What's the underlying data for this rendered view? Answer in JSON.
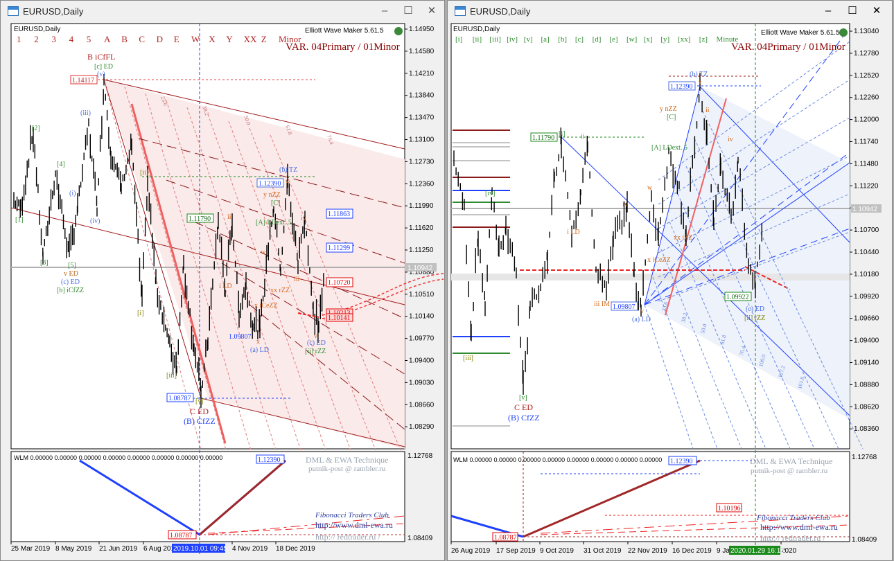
{
  "left": {
    "title": "EURUSD,Daily",
    "chart_label": "EURUSD,Daily",
    "ewm": "Elliott Wave Maker 5.61.5",
    "variant": "VAR. 04Primary / 01Minor",
    "wave_buttons": [
      "1",
      "2",
      "3",
      "4",
      "5",
      "A",
      "B",
      "C",
      "D",
      "E",
      "W",
      "X",
      "Y",
      "XX",
      "Z",
      "Minor"
    ],
    "price_axis": [
      "1.14950",
      "1.14580",
      "1.14210",
      "1.13840",
      "1.13470",
      "1.13100",
      "1.12730",
      "1.12360",
      "1.11990",
      "1.11620",
      "1.11250",
      "1.10880",
      "1.10510",
      "1.10140",
      "1.09770",
      "1.09400",
      "1.09030",
      "1.08660",
      "1.08290"
    ],
    "current_price": "1.10942",
    "price_tags": {
      "p1": "1.14117",
      "p2": "1.12390",
      "p3": "1.11790",
      "p4": "1.11863",
      "p5": "1.11299",
      "p6": "1.10720",
      "p7": "1.10213",
      "p8": "1.10141",
      "p9": "1.08787",
      "p10": "1.09807"
    },
    "wave_labels": {
      "bicfl": "B iCfFL",
      "ced1": "[c] ED",
      "v1": "(v)",
      "iii": "(iii)",
      "two": "[2]",
      "four": "[4]",
      "i": "(i)",
      "iv": "(iv)",
      "one": "[1]",
      "three": "[3]",
      "five": "[5]",
      "ved": "v ED",
      "ced2": "(c) ED",
      "bicfzz": "[b] iCfZZ",
      "ii2": "[ii]",
      "i2": "[i]",
      "iii2": "[iii]",
      "v2": "[v]",
      "ced": "C ED",
      "bcfzz": "(B) CfZZ",
      "btz": "(b) TZ",
      "ynzz": "y nZZ",
      "Cb": "[C]",
      "Aext": "[A] LDext. 5",
      "w": "w",
      "xrzz": "xx rZZ",
      "xiceZZ": "x iCeZZ",
      "ild": "i LD",
      "ii": "ii",
      "iv2": "iv",
      "iii3": "iii",
      "ald": "(a) LD",
      "ced3": "(c) ED",
      "iirzz": "[ii] rZZ",
      "z": "z",
      "y": "y",
      "x": "x",
      "vv": "v"
    },
    "indicator": {
      "label": "WLM 0.00000 0.00000 0.00000 0.00000 0.00000 0.00000 0.00000 0.00000",
      "high_tag": "1.12390",
      "low_tag": "1.08787",
      "axis_top": "1.12768",
      "axis_bottom": "1.08409"
    },
    "watermark": {
      "line1": "DML & EWA Technique",
      "line2": "putnik-post @ rambler.ru",
      "line3": "Fibonacci    Traders    Club",
      "line4": "http://www.dml-ewa.ru",
      "line5": "http:// redtrader.ru /"
    },
    "date_axis": [
      "25 Mar 2019",
      "8 May 2019",
      "21 Jun 2019",
      "6 Aug 2019",
      "4 Nov 2019",
      "18 Dec 2019"
    ],
    "cursor_date": "2019.10.01 09:45",
    "fib_labels": [
      "23.6",
      "38.2",
      "50.0",
      "61.8",
      "76.4"
    ]
  },
  "right": {
    "title": "EURUSD,Daily",
    "chart_label": "EURUSD,Daily",
    "ewm": "Elliott Wave Maker 5.61.5",
    "variant": "VAR. 04Primary / 01Minor",
    "wave_buttons": [
      "[i]",
      "[ii]",
      "[iii]",
      "[iv]",
      "[v]",
      "[a]",
      "[b]",
      "[c]",
      "[d]",
      "[e]",
      "[w]",
      "[x]",
      "[y]",
      "[xx]",
      "[z]",
      "Minute"
    ],
    "price_axis": [
      "1.13040",
      "1.12780",
      "1.12520",
      "1.12260",
      "1.12000",
      "1.11740",
      "1.11480",
      "1.11220",
      "1.10960",
      "1.10700",
      "1.10440",
      "1.10180",
      "1.09920",
      "1.09660",
      "1.09400",
      "1.09140",
      "1.08880",
      "1.08620",
      "1.08360"
    ],
    "current_price": "1.10942",
    "price_tags": {
      "p1": "1.12390",
      "p2": "1.11790",
      "p3": "1.09807",
      "p4": "1.09922"
    },
    "wave_labels": {
      "btz": "(b) TZ",
      "z": "z",
      "ynzz": "y nZZ",
      "Cb": "[C]",
      "Aext": "[A] LDext. 5",
      "i": "[i]",
      "ii": "ii",
      "ild": "i LD",
      "iv": "iv",
      "iv2": "[iv]",
      "iii": "[iii]",
      "iiiim": "iii IM",
      "v": "[v]",
      "ced": "C ED",
      "bcfzz": "(B) CfZZ",
      "w": "w",
      "xiceZZ": "x iCeZZ",
      "xxizz": "xx iZZ",
      "ald": "(a) LD",
      "vv": "v",
      "ii2": "ii",
      "ivc": "iv",
      "ced2": "(c) ED",
      "iirzz": "[ii] rZZ"
    },
    "indicator": {
      "label": "WLM 0.00000 0.00000 0.00000 0.00000 0.00000 0.00000 0.00000 0.00000",
      "high_tag": "1.12390",
      "low_tag": "1.08787",
      "mid_tag": "1.10196",
      "axis_top": "1.12768",
      "axis_bottom": "1.08409"
    },
    "watermark": {
      "line1": "DML & EWA Technique",
      "line2": "putnik-post @ rambler.ru",
      "line3": "Fibonacci    Traders    Club",
      "line4": "http://www.dml-ewa.ru",
      "line5": "http:// redtrader.ru /"
    },
    "date_axis": [
      "26 Aug 2019",
      "17 Sep 2019",
      "9 Oct 2019",
      "31 Oct 2019",
      "22 Nov 2019",
      "16 Dec 2019",
      "9 Ja",
      "2020"
    ],
    "cursor_date": "2020.01.29 16:15",
    "fib_labels": [
      "23.6",
      "38.2",
      "50.0",
      "61.8",
      "76.4",
      "100.0",
      "127.2",
      "161.8"
    ]
  },
  "window_controls": {
    "minimize": "–",
    "maximize": "☐",
    "close": "✕"
  },
  "colors": {
    "bull_bear": "#000000",
    "wave_red": "#b22222",
    "minor_blue": "#1e40ff",
    "fan_pink": "#fbeaea",
    "fan_blue": "#eef2fb",
    "green": "#2e8b2e"
  }
}
